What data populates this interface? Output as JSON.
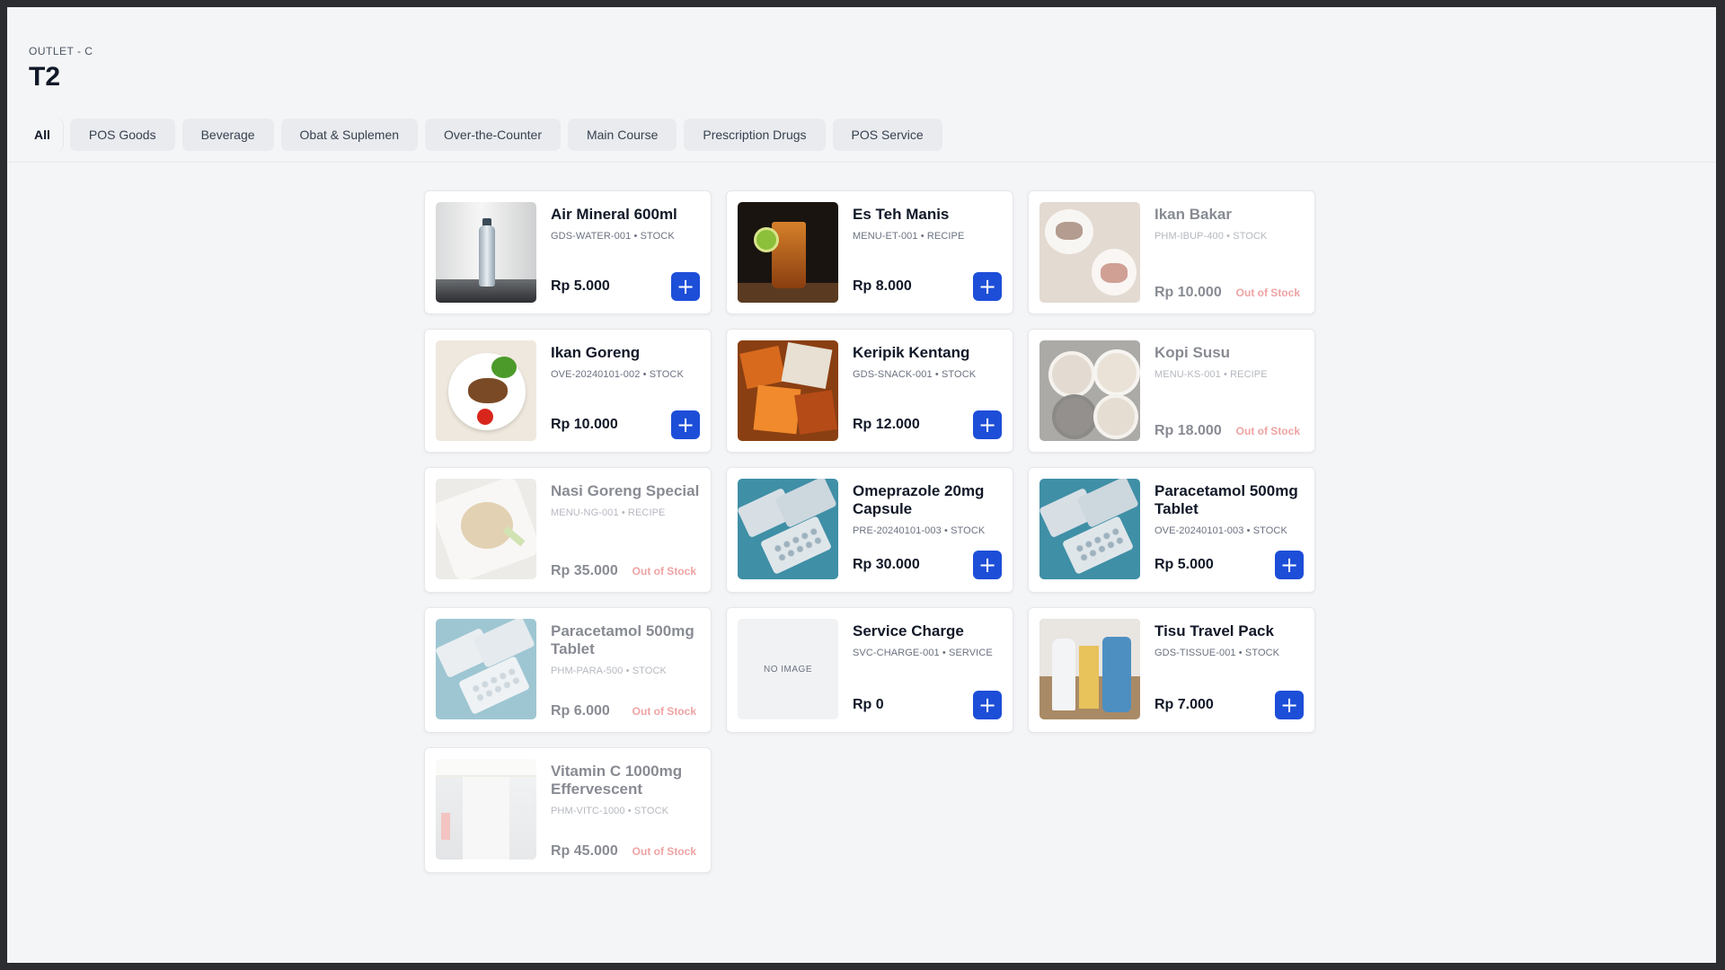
{
  "header": {
    "outlet": "OUTLET - C",
    "title": "T2"
  },
  "tabs": [
    {
      "label": "All",
      "active": true
    },
    {
      "label": "POS Goods"
    },
    {
      "label": "Beverage"
    },
    {
      "label": "Obat & Suplemen"
    },
    {
      "label": "Over-the-Counter"
    },
    {
      "label": "Main Course"
    },
    {
      "label": "Prescription Drugs"
    },
    {
      "label": "POS Service"
    }
  ],
  "products": [
    {
      "name": "Air Mineral 600ml",
      "meta": "GDS-WATER-001 • STOCK",
      "price": "Rp 5.000",
      "status": "",
      "image": "water-bottle"
    },
    {
      "name": "Es Teh Manis",
      "meta": "MENU-ET-001 • RECIPE",
      "price": "Rp 8.000",
      "status": "",
      "image": "iced-tea"
    },
    {
      "name": "Ikan Bakar",
      "meta": "PHM-IBUP-400 • STOCK",
      "price": "Rp 10.000",
      "status": "Out of Stock",
      "image": "grilled-fish"
    },
    {
      "name": "Ikan Goreng",
      "meta": "OVE-20240101-002 • STOCK",
      "price": "Rp 10.000",
      "status": "",
      "image": "fried-fish"
    },
    {
      "name": "Keripik Kentang",
      "meta": "GDS-SNACK-001 • STOCK",
      "price": "Rp 12.000",
      "status": "",
      "image": "potato-chips"
    },
    {
      "name": "Kopi Susu",
      "meta": "MENU-KS-001 • RECIPE",
      "price": "Rp 18.000",
      "status": "Out of Stock",
      "image": "coffee-cups"
    },
    {
      "name": "Nasi Goreng Special",
      "meta": "MENU-NG-001 • RECIPE",
      "price": "Rp 35.000",
      "status": "Out of Stock",
      "image": "fried-rice"
    },
    {
      "name": "Omeprazole 20mg Capsule",
      "meta": "PRE-20240101-003 • STOCK",
      "price": "Rp 30.000",
      "status": "",
      "image": "pill-blisters"
    },
    {
      "name": "Paracetamol 500mg Tablet",
      "meta": "OVE-20240101-003 • STOCK",
      "price": "Rp 5.000",
      "status": "",
      "image": "pill-blisters"
    },
    {
      "name": "Paracetamol 500mg Tablet",
      "meta": "PHM-PARA-500 • STOCK",
      "price": "Rp 6.000",
      "status": "Out of Stock",
      "image": "pill-blisters"
    },
    {
      "name": "Service Charge",
      "meta": "SVC-CHARGE-001 • SERVICE",
      "price": "Rp 0",
      "status": "",
      "image": "none",
      "placeholder": "NO IMAGE"
    },
    {
      "name": "Tisu Travel Pack",
      "meta": "GDS-TISSUE-001 • STOCK",
      "price": "Rp 7.000",
      "status": "",
      "image": "cleaning-bottles"
    },
    {
      "name": "Vitamin C 1000mg Effervescent",
      "meta": "PHM-VITC-1000 • STOCK",
      "price": "Rp 45.000",
      "status": "Out of Stock",
      "image": "pharmacy-shelves"
    }
  ],
  "add_button_label": "+",
  "colors": {
    "accent": "#1d4ed8",
    "out_of_stock": "#e04848",
    "background": "#f4f5f7"
  }
}
